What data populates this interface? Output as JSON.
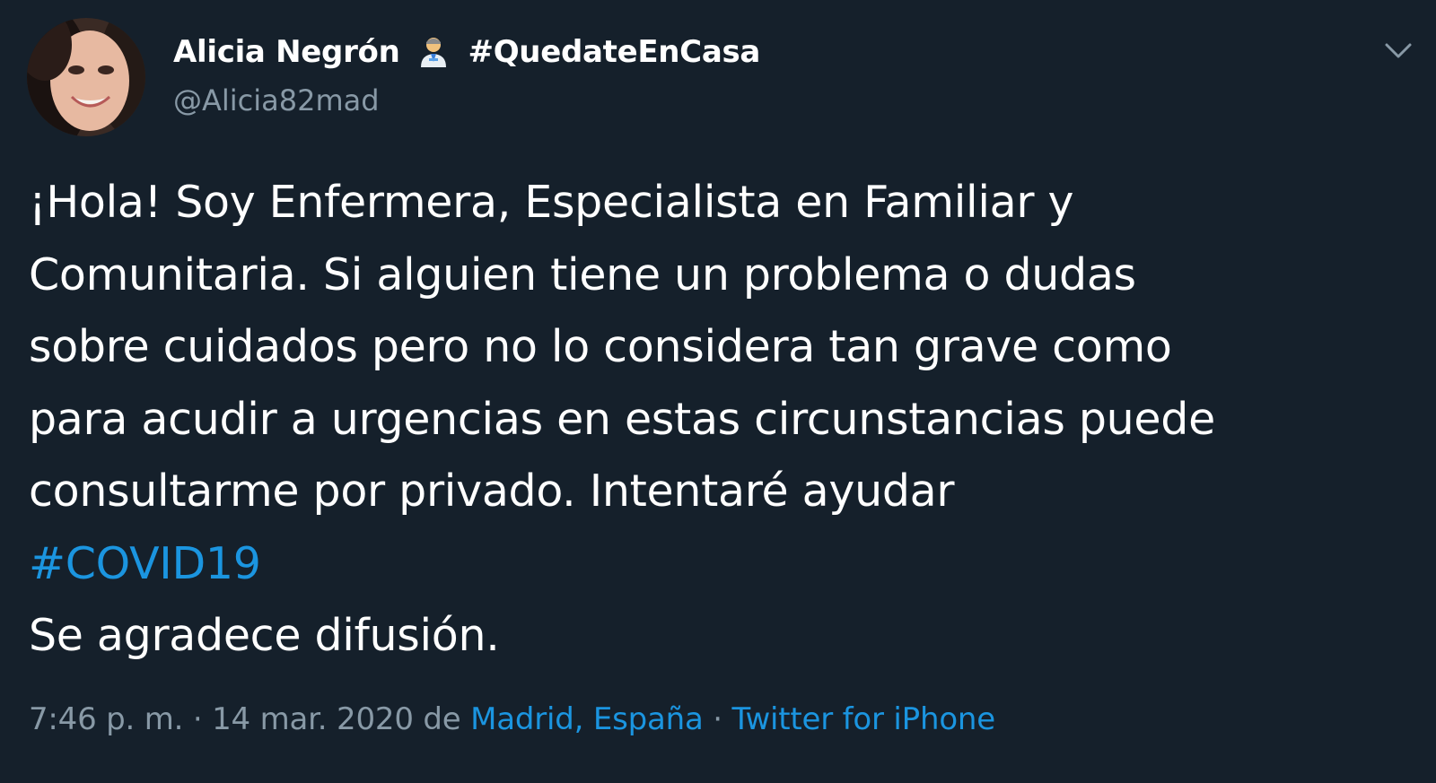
{
  "author": {
    "display_name": "Alicia Negrón",
    "name_suffix": "#QuedateEnCasa",
    "handle": "@Alicia82mad",
    "avatar_icon": "profile-photo",
    "badge_icon": "health-worker-emoji"
  },
  "tweet": {
    "lines": [
      "¡Hola! Soy Enfermera, Especialista en Familiar y",
      "Comunitaria. Si alguien tiene un problema o dudas",
      "sobre cuidados pero no lo considera tan grave como",
      "para acudir a urgencias en estas circunstancias puede",
      "consultarme por privado. Intentaré ayudar"
    ],
    "hashtag": "#COVID19",
    "closing": "Se agradece difusión."
  },
  "meta": {
    "time": "7:46 p. m.",
    "sep1": " · ",
    "date": "14 mar. 2020",
    "de": " de ",
    "location": "Madrid, España",
    "sep2": " · ",
    "source": "Twitter for iPhone"
  },
  "menu": {
    "icon": "chevron-down-icon"
  },
  "colors": {
    "background": "#15202b",
    "text": "#ffffff",
    "secondary": "#8899a6",
    "link": "#1b95e0"
  }
}
